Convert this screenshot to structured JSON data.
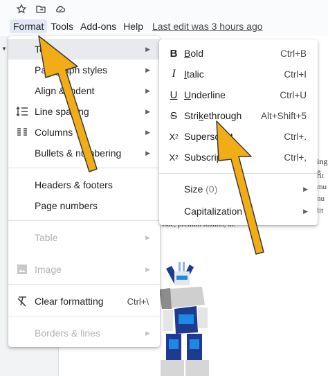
{
  "top_icons": [
    "star-icon",
    "move-to-folder-icon",
    "cloud-saved-icon"
  ],
  "menubar": {
    "items": [
      "Format",
      "Tools",
      "Add-ons",
      "Help"
    ],
    "last_edit": "Last edit was 3 hours ago"
  },
  "format_menu": {
    "items": [
      {
        "label": "Text",
        "icon": "",
        "submenu": true,
        "highlighted": true
      },
      {
        "label": "Paragraph styles",
        "icon": "",
        "submenu": true
      },
      {
        "label": "Align & indent",
        "icon": "",
        "submenu": true
      },
      {
        "label": "Line spacing",
        "icon": "line-spacing-icon",
        "submenu": true
      },
      {
        "label": "Columns",
        "icon": "columns-icon",
        "submenu": true
      },
      {
        "label": "Bullets & numbering",
        "icon": "",
        "submenu": true
      },
      {
        "label": "Headers & footers",
        "icon": "",
        "submenu": false
      },
      {
        "label": "Page numbers",
        "icon": "",
        "submenu": false
      },
      {
        "label": "Table",
        "icon": "",
        "submenu": true,
        "disabled": true
      },
      {
        "label": "Image",
        "icon": "image-icon",
        "submenu": true,
        "disabled": true
      },
      {
        "label": "Clear formatting",
        "icon": "clear-formatting-icon",
        "shortcut": "Ctrl+\\"
      },
      {
        "label": "Borders & lines",
        "icon": "",
        "submenu": true,
        "disabled": true
      }
    ]
  },
  "text_submenu": {
    "items": [
      {
        "label": "Bold",
        "mnemonic": "B",
        "icon": "bold-icon",
        "shortcut": "Ctrl+B"
      },
      {
        "label": "Italic",
        "mnemonic": "I",
        "icon": "italic-icon",
        "shortcut": "Ctrl+I"
      },
      {
        "label": "Underline",
        "mnemonic": "U",
        "icon": "underline-icon",
        "shortcut": "Ctrl+U"
      },
      {
        "label": "Strikethrough",
        "mnemonic": "k",
        "icon": "strikethrough-icon",
        "shortcut": "Alt+Shift+5"
      },
      {
        "label": "Superscript",
        "mnemonic": "",
        "icon": "superscript-icon",
        "shortcut": "Ctrl+."
      },
      {
        "label": "Subscript",
        "mnemonic": "",
        "icon": "subscript-icon",
        "shortcut": "Ctrl+,"
      },
      {
        "label": "Size",
        "note": "(0)",
        "submenu": true
      },
      {
        "label": "Capitalization",
        "note": "",
        "submenu": true
      }
    ]
  },
  "doc_text": {
    "line1": "ing e",
    "line2": "rit",
    "line3": "mu",
    "line4": "nu",
    "line5": "lit",
    "line6": "viae, pretium mauris, in. "
  },
  "colors": {
    "highlight": "#e8eaed",
    "annotation_arrow": "#f2ad16"
  }
}
